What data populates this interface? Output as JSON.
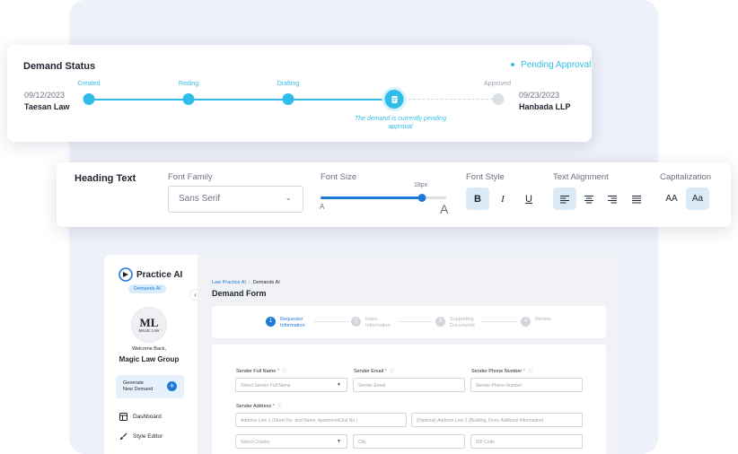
{
  "status": {
    "title": "Demand Status",
    "badge": "Pending Approval",
    "from": {
      "date": "09/12/2023",
      "name": "Taesan Law"
    },
    "to": {
      "date": "09/23/2023",
      "name": "Hanbada LLP"
    },
    "steps": [
      "Created",
      "Reding",
      "Drafting",
      "Approved"
    ],
    "current_note": "The demand is currently pending approval",
    "colors": {
      "accent": "#31bde9",
      "inactive": "#dcdfe4"
    }
  },
  "style_toolbar": {
    "heading": "Heading Text",
    "font_family_label": "Font Family",
    "font_family_value": "Sans Serif",
    "font_size_label": "Font Size",
    "font_size_value": "18px",
    "font_size_fraction": 0.81,
    "slider_min_label": "A",
    "slider_max_label": "A",
    "font_style_label": "Font Style",
    "bold": "B",
    "italic": "I",
    "underline": "U",
    "alignment_label": "Text Alignment",
    "capitalization_label": "Capitalization",
    "caps_upper": "AA",
    "caps_title": "Aa"
  },
  "app": {
    "brand": "Practice AI",
    "brand_chip": "Demands AI",
    "avatar_initials": "ML",
    "avatar_caption": "MAGIC LAW",
    "welcome": "Welcome Back,",
    "org_name": "Magic Law Group",
    "generate_line1": "Generate",
    "generate_line2": "New Demand",
    "nav": [
      "Dashboard",
      "Style Editor"
    ],
    "breadcrumb": [
      "Law Practice AI",
      "Demands AI"
    ],
    "page_title": "Demand Form",
    "wizard": [
      {
        "num": "1",
        "label": "Requestor Information"
      },
      {
        "num": "2",
        "label": "Index Information"
      },
      {
        "num": "3",
        "label": "Supporting Documents"
      },
      {
        "num": "4",
        "label": "Review"
      }
    ],
    "form": {
      "sender_full_name_label": "Sender Full Name",
      "sender_full_name_placeholder": "Select Sender Full Name",
      "sender_email_label": "Sender Email",
      "sender_email_placeholder": "Sender Email",
      "sender_phone_label": "Sender Phone Number",
      "sender_phone_placeholder": "Sender Phone Number",
      "sender_address_label": "Sender Address",
      "address1_placeholder": "Address Line 1 (Street No. and Name, Apartment/Unit No.)",
      "address2_placeholder": "(Optional) Address Line 2 (Building, Floor, Addional Information)",
      "country_placeholder": "Select Country",
      "city_placeholder": "City",
      "zip_placeholder": "ZIP Code",
      "required_mark": "*",
      "info_mark": "ⓘ"
    }
  }
}
